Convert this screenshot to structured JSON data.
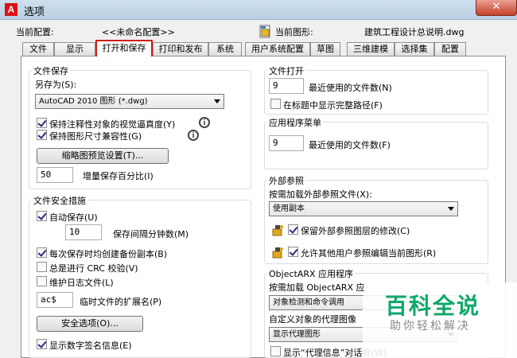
{
  "window": {
    "title": "选项",
    "close_label": "✕",
    "app_icon_letter": "A"
  },
  "current": {
    "config_label": "当前配置:",
    "config_value": "<<未命名配置>>",
    "drawing_label": "当前图形:",
    "drawing_value": "建筑工程设计总说明.dwg"
  },
  "tabs": [
    "文件",
    "显示",
    "打开和保存",
    "打印和发布",
    "系统",
    "用户系统配置",
    "草图",
    "三维建模",
    "选择集",
    "配置"
  ],
  "file_save": {
    "title": "文件保存",
    "save_as_label": "另存为(S):",
    "save_as_value": "AutoCAD 2010 图形 (*.dwg)",
    "maintain_visual": "保持注释性对象的视觉逼真度(Y)",
    "maintain_size": "保持图形尺寸兼容性(G)",
    "thumbnail_button": "缩略图预览设置(T)...",
    "incremental_value": "50",
    "incremental_label": "增量保存百分比(I)"
  },
  "safety": {
    "title": "文件安全措施",
    "autosave": "自动保存(U)",
    "minutes_value": "10",
    "minutes_label": "保存间隔分钟数(M)",
    "backup": "每次保存时均创建备份副本(B)",
    "crc": "总是进行 CRC 校验(V)",
    "log": "维护日志文件(L)",
    "temp_ext_value": "ac$",
    "temp_ext_label": "临时文件的扩展名(P)",
    "security_button": "安全选项(O)...",
    "digital_sig": "显示数字签名信息(E)"
  },
  "file_open": {
    "title": "文件打开",
    "recent_value": "9",
    "recent_label": "最近使用的文件数(N)",
    "full_path": "在标题中显示完整路径(F)"
  },
  "app_menu": {
    "title": "应用程序菜单",
    "recent_value": "9",
    "recent_label": "最近使用的文件数(F)"
  },
  "xref": {
    "title": "外部参照",
    "demand_label": "按需加载外部参照文件(X):",
    "demand_value": "使用副本",
    "retain": "保留外部参照图层的修改(C)",
    "allow_edit": "允许其他用户参照编辑当前图形(R)"
  },
  "arx": {
    "title": "ObjectARX 应用程序",
    "demand_label": "按需加载 ObjectARX 应",
    "demand_value": "对象检测和命令调用",
    "proxy_label": "自定义对象的代理图像",
    "proxy_value": "显示代理图形",
    "proxy_info": "显示“代理信息”对话框(W)"
  },
  "watermark": {
    "title": "百科全说",
    "subtitle": "助你轻松解决"
  },
  "colors": {
    "active_tab_border": "#d0201b",
    "watermark_green": "#0da86a"
  }
}
